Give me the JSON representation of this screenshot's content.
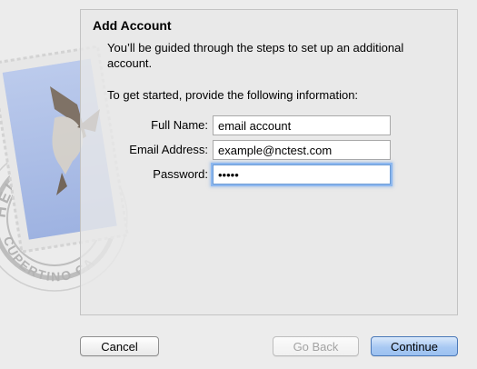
{
  "panel": {
    "title": "Add Account",
    "intro": "You’ll be guided through the steps to set up an additional account.",
    "prompt": "To get started, provide the following information:"
  },
  "form": {
    "full_name_label": "Full Name:",
    "full_name_value": "email account",
    "email_label": "Email Address:",
    "email_value": "example@nctest.com",
    "password_label": "Password:",
    "password_value": "•••••"
  },
  "buttons": {
    "cancel": "Cancel",
    "go_back": "Go Back",
    "continue": "Continue"
  },
  "backdrop": {
    "stamp_text_top": "HELLO FR",
    "stamp_text_bottom": "CUPERTINO CA",
    "icon": "mail-stamp-eagle-icon"
  },
  "colors": {
    "accent": "#6b9bd6",
    "continue_button": "#a9c9f3"
  }
}
